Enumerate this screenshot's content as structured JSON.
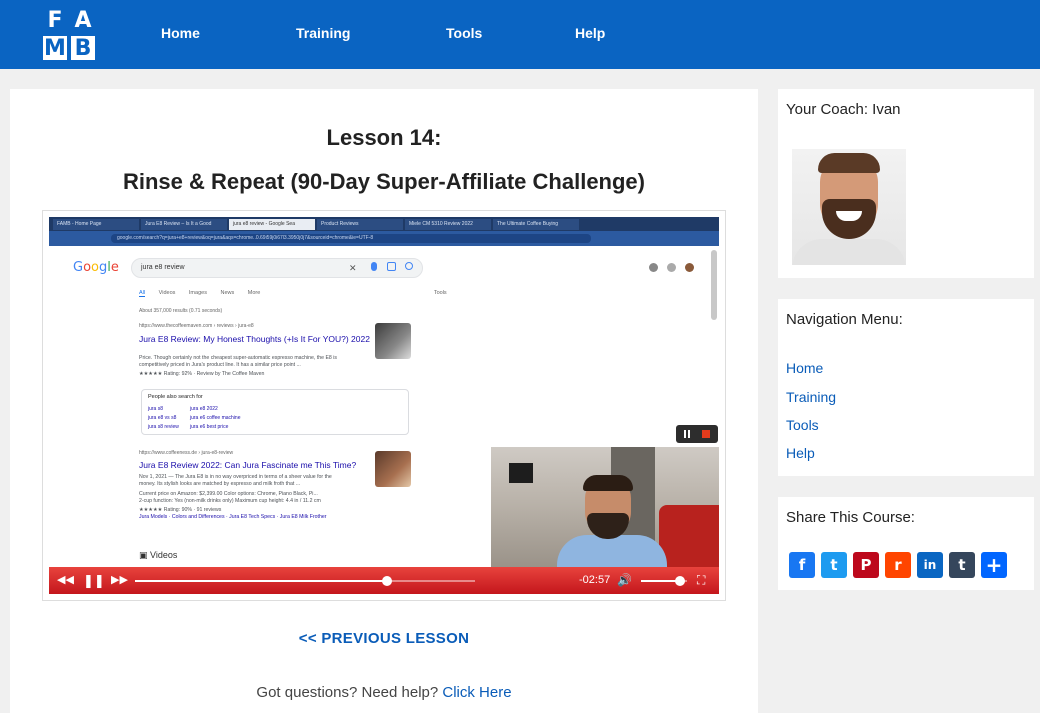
{
  "header": {
    "logo_letters": [
      "F",
      "A",
      "M",
      "B"
    ],
    "nav": [
      {
        "label": "Home"
      },
      {
        "label": "Training"
      },
      {
        "label": "Tools"
      },
      {
        "label": "Help"
      }
    ],
    "bg_color": "#0a64c2"
  },
  "lesson": {
    "number": "Lesson 14:",
    "title": "Rinse & Repeat (90-Day Super-Affiliate Challenge)"
  },
  "video": {
    "browser_tabs": [
      "FAMB - Home Page",
      "Jura E8 Review – Is It a Good",
      "jura e8 review - Google Sea",
      "Product Reviews",
      "Miele CM 5310 Review 2022",
      "The Ultimate Coffee Buying"
    ],
    "url": "google.com/search?q=jura+e8+review&oq=jura&aqs=chrome..0.69i59j0i67l3.3950j0j7&sourceid=chrome&ie=UTF-8",
    "search_query": "jura e8 review",
    "search_tabs": [
      "All",
      "Videos",
      "Images",
      "News",
      "More",
      "Tools"
    ],
    "results_count": "About 357,000 results (0.71 seconds)",
    "result1": {
      "url": "https://www.thecoffeemaven.com › reviews › jura-e8",
      "title": "Jura E8 Review: My Honest Thoughts (+Is It For YOU?) 2022",
      "snippet1": "Price. Though certainly not the cheapest super-automatic espresso machine, the E8 is",
      "snippet2": "competitively priced in Jura's product line. It has a similar price point ...",
      "rating": "★★★★★ Rating: 92% · Review by The Coffee Maven"
    },
    "people_also_search": {
      "heading": "People also search for",
      "items": [
        "jura s8",
        "jura e8 2022",
        "jura e8 vs s8",
        "jura e6 coffee machine",
        "jura s8 review",
        "jura e6 best price"
      ]
    },
    "result2": {
      "url": "https://www.coffeeness.de › jura-e8-review",
      "title": "Jura E8 Review 2022: Can Jura Fascinate me This Time?",
      "snippet1": "Nov 1, 2021 — The Jura E8 is in no way overpriced in terms of a sheer value for the",
      "snippet2": "money. Its stylish looks are matched by espresso and milk froth that ...",
      "meta1": "Current price on Amazon: $2,399.00        Color options: Chrome, Piano Black, Pi...",
      "meta2": "2-cup function: Yes (non-milk drinks only)    Maximum cup height: 4.4 in / 11.2 cm",
      "rating": "★★★★★ Rating: 90% · 91 reviews",
      "links": "Jura Models · Colors and Differences · Jura E8 Tech Specs · Jura E8 Milk Frother"
    },
    "videos_label": "Videos",
    "time_remaining": "-02:57",
    "progress": 0.74,
    "volume": 0.85
  },
  "prev_lesson": "<< PREVIOUS LESSON",
  "help": {
    "text": "Got questions? Need help?",
    "link": "Click Here"
  },
  "sidebar": {
    "coach_title": "Your Coach: Ivan",
    "nav_title": "Navigation Menu:",
    "nav_items": [
      {
        "label": "Home"
      },
      {
        "label": "Training"
      },
      {
        "label": "Tools"
      },
      {
        "label": "Help"
      }
    ],
    "share_title": "Share This Course:",
    "share_buttons": [
      {
        "icon": "facebook-icon",
        "glyph": "f",
        "color": "#1877f2"
      },
      {
        "icon": "twitter-icon",
        "glyph": "t",
        "color": "#1d9bf0"
      },
      {
        "icon": "pinterest-icon",
        "glyph": "P",
        "color": "#bd081c"
      },
      {
        "icon": "reddit-icon",
        "glyph": "r",
        "color": "#ff4500"
      },
      {
        "icon": "linkedin-icon",
        "glyph": "in",
        "color": "#0a66c2"
      },
      {
        "icon": "tumblr-icon",
        "glyph": "t",
        "color": "#35465c"
      },
      {
        "icon": "addtoany-icon",
        "glyph": "+",
        "color": "#0166ff"
      }
    ]
  }
}
